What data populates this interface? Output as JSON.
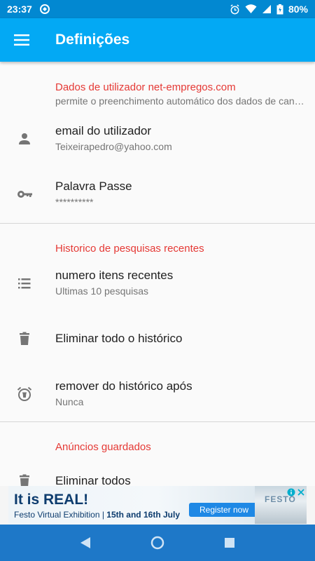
{
  "status_bar": {
    "time": "23:37",
    "battery": "80%"
  },
  "app_bar": {
    "title": "Definições"
  },
  "sections": [
    {
      "header": "Dados de utilizador net-empregos.com",
      "subheader": "permite o preenchimento automático dos dados de candidatura",
      "items": [
        {
          "primary": "email do utilizador",
          "secondary": "Teixeirapedro@yahoo.com",
          "icon": "person-icon"
        },
        {
          "primary": "Palavra Passe",
          "secondary": "**********",
          "icon": "key-icon"
        }
      ]
    },
    {
      "header": "Historico de pesquisas recentes",
      "items": [
        {
          "primary": "numero itens recentes",
          "secondary": "Ultimas 10 pesquisas",
          "icon": "list-icon"
        },
        {
          "primary": "Eliminar todo o histórico",
          "icon": "trash-icon"
        },
        {
          "primary": "remover do histórico após",
          "secondary": "Nunca",
          "icon": "alarm-icon"
        }
      ]
    },
    {
      "header": "Anúncios guardados",
      "items": [
        {
          "primary": "Eliminar todos",
          "icon": "trash-icon"
        }
      ]
    }
  ],
  "ad": {
    "title": "It is REAL!",
    "subtitle_start": "Festo Virtual Exhibition | ",
    "subtitle_bold": "15th and 16th July",
    "button": "Register now",
    "brand": "FESTO"
  },
  "colors": {
    "app_bar": "#03a9f4",
    "status_bar": "#0288d1",
    "accent": "#e53935",
    "nav_bar": "#1e78c8"
  }
}
